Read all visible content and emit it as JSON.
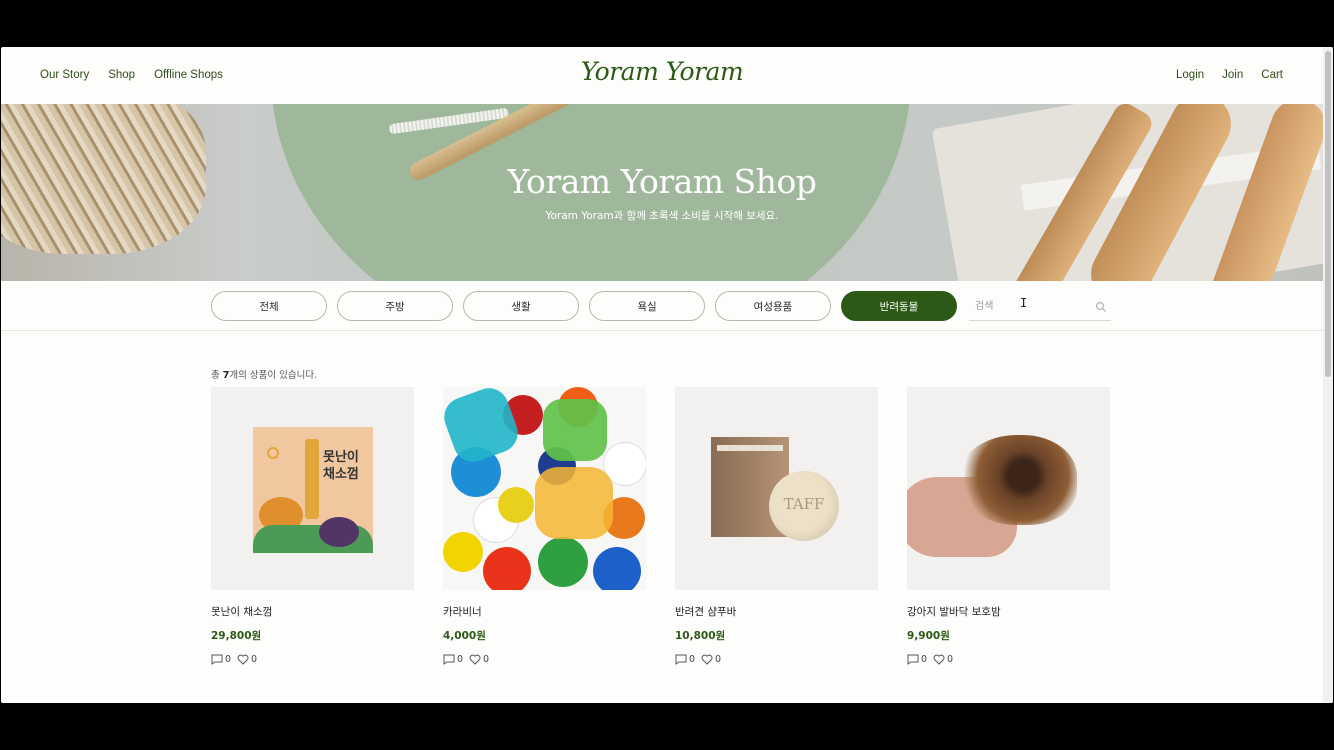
{
  "header": {
    "nav_left": [
      "Our Story",
      "Shop",
      "Offline Shops"
    ],
    "logo": "Yoram Yoram",
    "nav_right": [
      "Login",
      "Join",
      "Cart"
    ]
  },
  "hero": {
    "title": "Yoram Yoram Shop",
    "subtitle": "Yoram Yoram과 함께 초록색 소비를 시작해 보세요."
  },
  "categories": {
    "items": [
      "전체",
      "주방",
      "생활",
      "욕실",
      "여성용품",
      "반려동물"
    ],
    "active": "반려동물"
  },
  "search": {
    "placeholder": "검색"
  },
  "results": {
    "prefix": "총 ",
    "count": "7",
    "suffix": "개의 상품이 있습니다."
  },
  "products": [
    {
      "name": "못난이 채소껌",
      "price": "29,800원",
      "comments": "0",
      "likes": "0",
      "package_text": "못난이\n채소껌"
    },
    {
      "name": "카라비너",
      "price": "4,000원",
      "comments": "0",
      "likes": "0"
    },
    {
      "name": "반려견 샴푸바",
      "price": "10,800원",
      "comments": "0",
      "likes": "0",
      "soap_text": "TAFF"
    },
    {
      "name": "강아지 발바닥 보호밤",
      "price": "9,900원",
      "comments": "0",
      "likes": "0"
    }
  ],
  "colors": {
    "brand": "#2c5a16",
    "background": "#fdfdfb"
  },
  "icons": {
    "comment": "comment-icon",
    "like": "heart-icon",
    "search": "search-icon"
  }
}
